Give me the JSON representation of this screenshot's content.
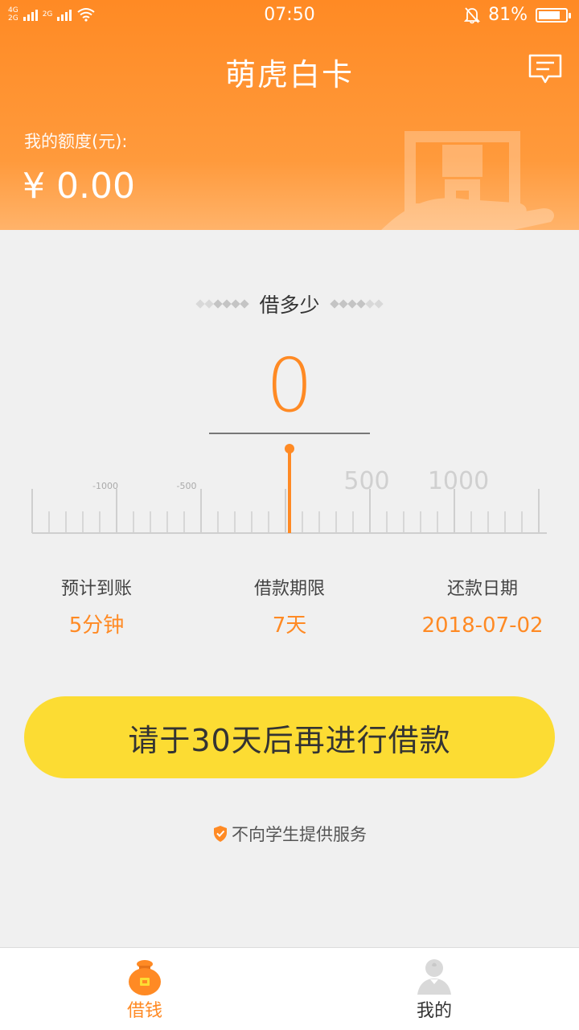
{
  "status_bar": {
    "network_top": "4G",
    "network_bottom": "2G",
    "network_2": "2G",
    "time": "07:50",
    "battery": "81%",
    "battery_level": 0.81
  },
  "header": {
    "title": "萌虎白卡",
    "quota_label": "我的额度(元):",
    "quota_value": "¥ 0.00"
  },
  "loan": {
    "section_title": "借多少",
    "amount": "0",
    "ruler_labels": [
      "-1000",
      "-500",
      "500",
      "1000"
    ]
  },
  "info": [
    {
      "label": "预计到账",
      "value": "5分钟"
    },
    {
      "label": "借款期限",
      "value": "7天"
    },
    {
      "label": "还款日期",
      "value": "2018-07-02"
    }
  ],
  "action_button": "请于30天后再进行借款",
  "notice": "不向学生提供服务",
  "tabs": [
    {
      "label": "借钱",
      "icon": "money-bag-icon",
      "active": true
    },
    {
      "label": "我的",
      "icon": "user-icon",
      "active": false
    }
  ],
  "colors": {
    "accent": "#ff8a24",
    "button": "#fcdc33",
    "background": "#f0f0f0"
  }
}
